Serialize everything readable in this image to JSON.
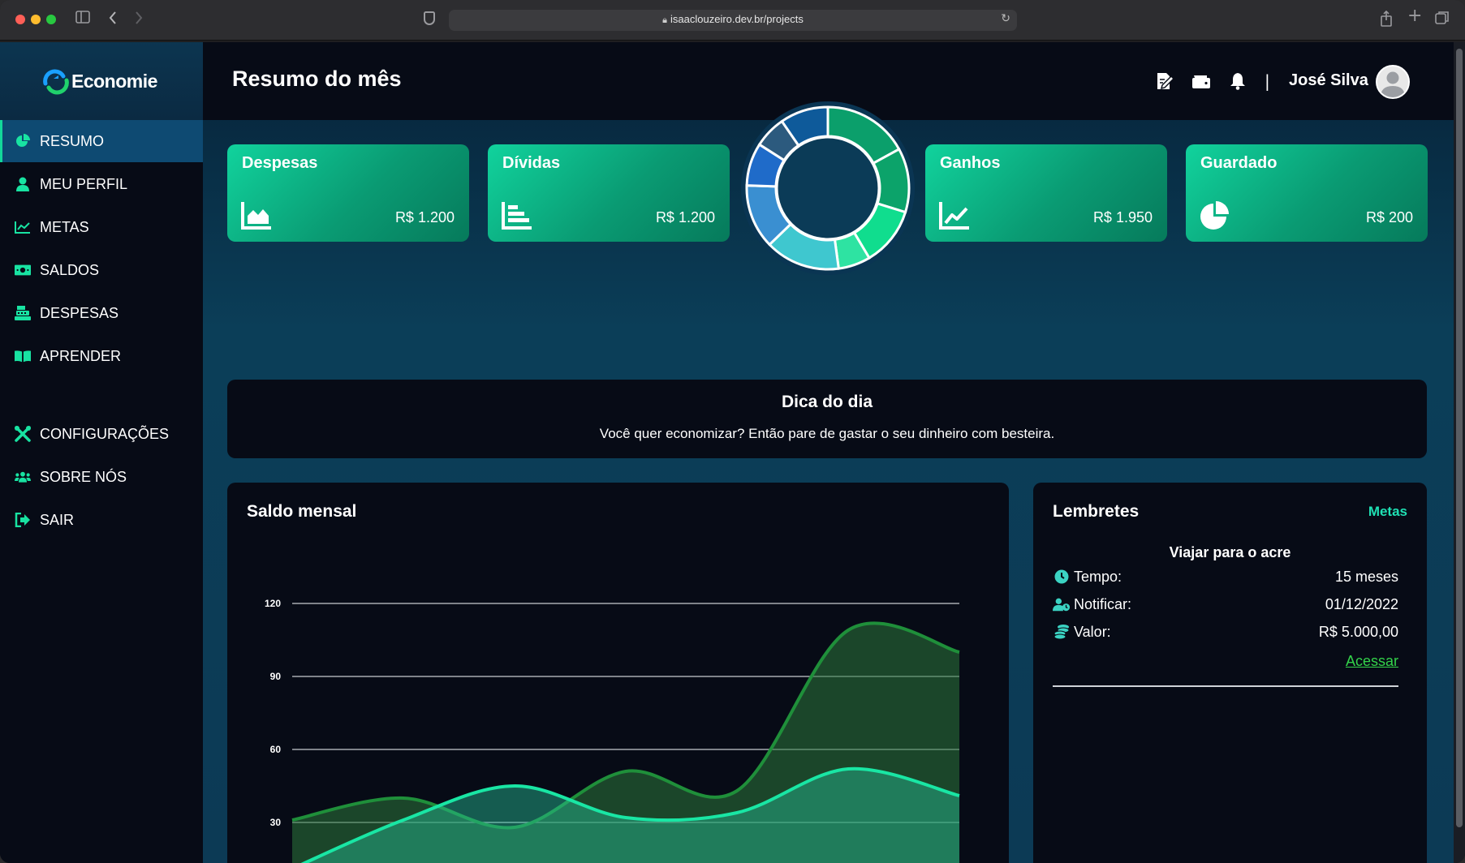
{
  "browser": {
    "url": "isaaclouzeiro.dev.br/projects"
  },
  "brand": {
    "name": "Economie",
    "accent": "#13d89a",
    "sidebar_bg": "#070b16"
  },
  "sidebar": {
    "items": [
      {
        "label": "RESUMO",
        "icon": "pie-chart-icon",
        "active": true
      },
      {
        "label": "MEU PERFIL",
        "icon": "user-icon"
      },
      {
        "label": "METAS",
        "icon": "line-chart-icon"
      },
      {
        "label": "SALDOS",
        "icon": "money-bill-icon"
      },
      {
        "label": "DESPESAS",
        "icon": "cash-register-icon"
      },
      {
        "label": "APRENDER",
        "icon": "book-open-icon"
      },
      {
        "label": "CONFIGURAÇÕES",
        "icon": "tools-icon"
      },
      {
        "label": "SOBRE NÓS",
        "icon": "users-icon"
      },
      {
        "label": "SAIR",
        "icon": "sign-out-icon"
      }
    ]
  },
  "header": {
    "title": "Resumo do mês",
    "separator": "|",
    "user_name": "José Silva",
    "icons": [
      "edit-document-icon",
      "wallet-icon",
      "bell-icon"
    ]
  },
  "cards": [
    {
      "title": "Despesas",
      "value": "R$ 1.200",
      "icon": "area-chart-icon"
    },
    {
      "title": "Dívidas",
      "value": "R$ 1.200",
      "icon": "bar-chart-icon"
    },
    {
      "title": "Ganhos",
      "value": "R$ 1.950",
      "icon": "line-chart-icon"
    },
    {
      "title": "Guardado",
      "value": "R$ 200",
      "icon": "pie-chart-icon"
    }
  ],
  "tip": {
    "title": "Dica do dia",
    "text": "Você quer economizar? Então pare de gastar o seu dinheiro com besteira."
  },
  "chart_panel": {
    "title": "Saldo mensal"
  },
  "chart_data": [
    {
      "type": "pie",
      "values": [
        16,
        12,
        11,
        6,
        14,
        12,
        8,
        6,
        9
      ],
      "colors": [
        "#0b9f6b",
        "#0ca36a",
        "#10dd8e",
        "#2ee3a2",
        "#3fc7cf",
        "#3a8fd1",
        "#1f6bc9",
        "#2c5a7e",
        "#0e5a9a"
      ]
    },
    {
      "type": "area",
      "x": [
        0,
        1,
        2,
        3,
        4,
        5,
        6
      ],
      "ylim": [
        0,
        120
      ],
      "yticks": [
        0,
        30,
        60,
        90,
        120
      ],
      "series": [
        {
          "values": [
            31,
            40,
            28,
            51,
            43,
            109,
            100
          ],
          "color": "#1f8f3a"
        },
        {
          "values": [
            11,
            31,
            45,
            32,
            34,
            52,
            41
          ],
          "color": "#19e6a4"
        }
      ]
    }
  ],
  "reminders": {
    "title": "Lembretes",
    "link": "Metas",
    "subtitle": "Viajar para o acre",
    "rows": [
      {
        "icon": "clock-icon",
        "label": "Tempo:",
        "value": "15 meses"
      },
      {
        "icon": "user-clock-icon",
        "label": "Notificar:",
        "value": "01/12/2022"
      },
      {
        "icon": "coins-icon",
        "label": "Valor:",
        "value": "R$ 5.000,00"
      }
    ],
    "action": "Acessar"
  }
}
